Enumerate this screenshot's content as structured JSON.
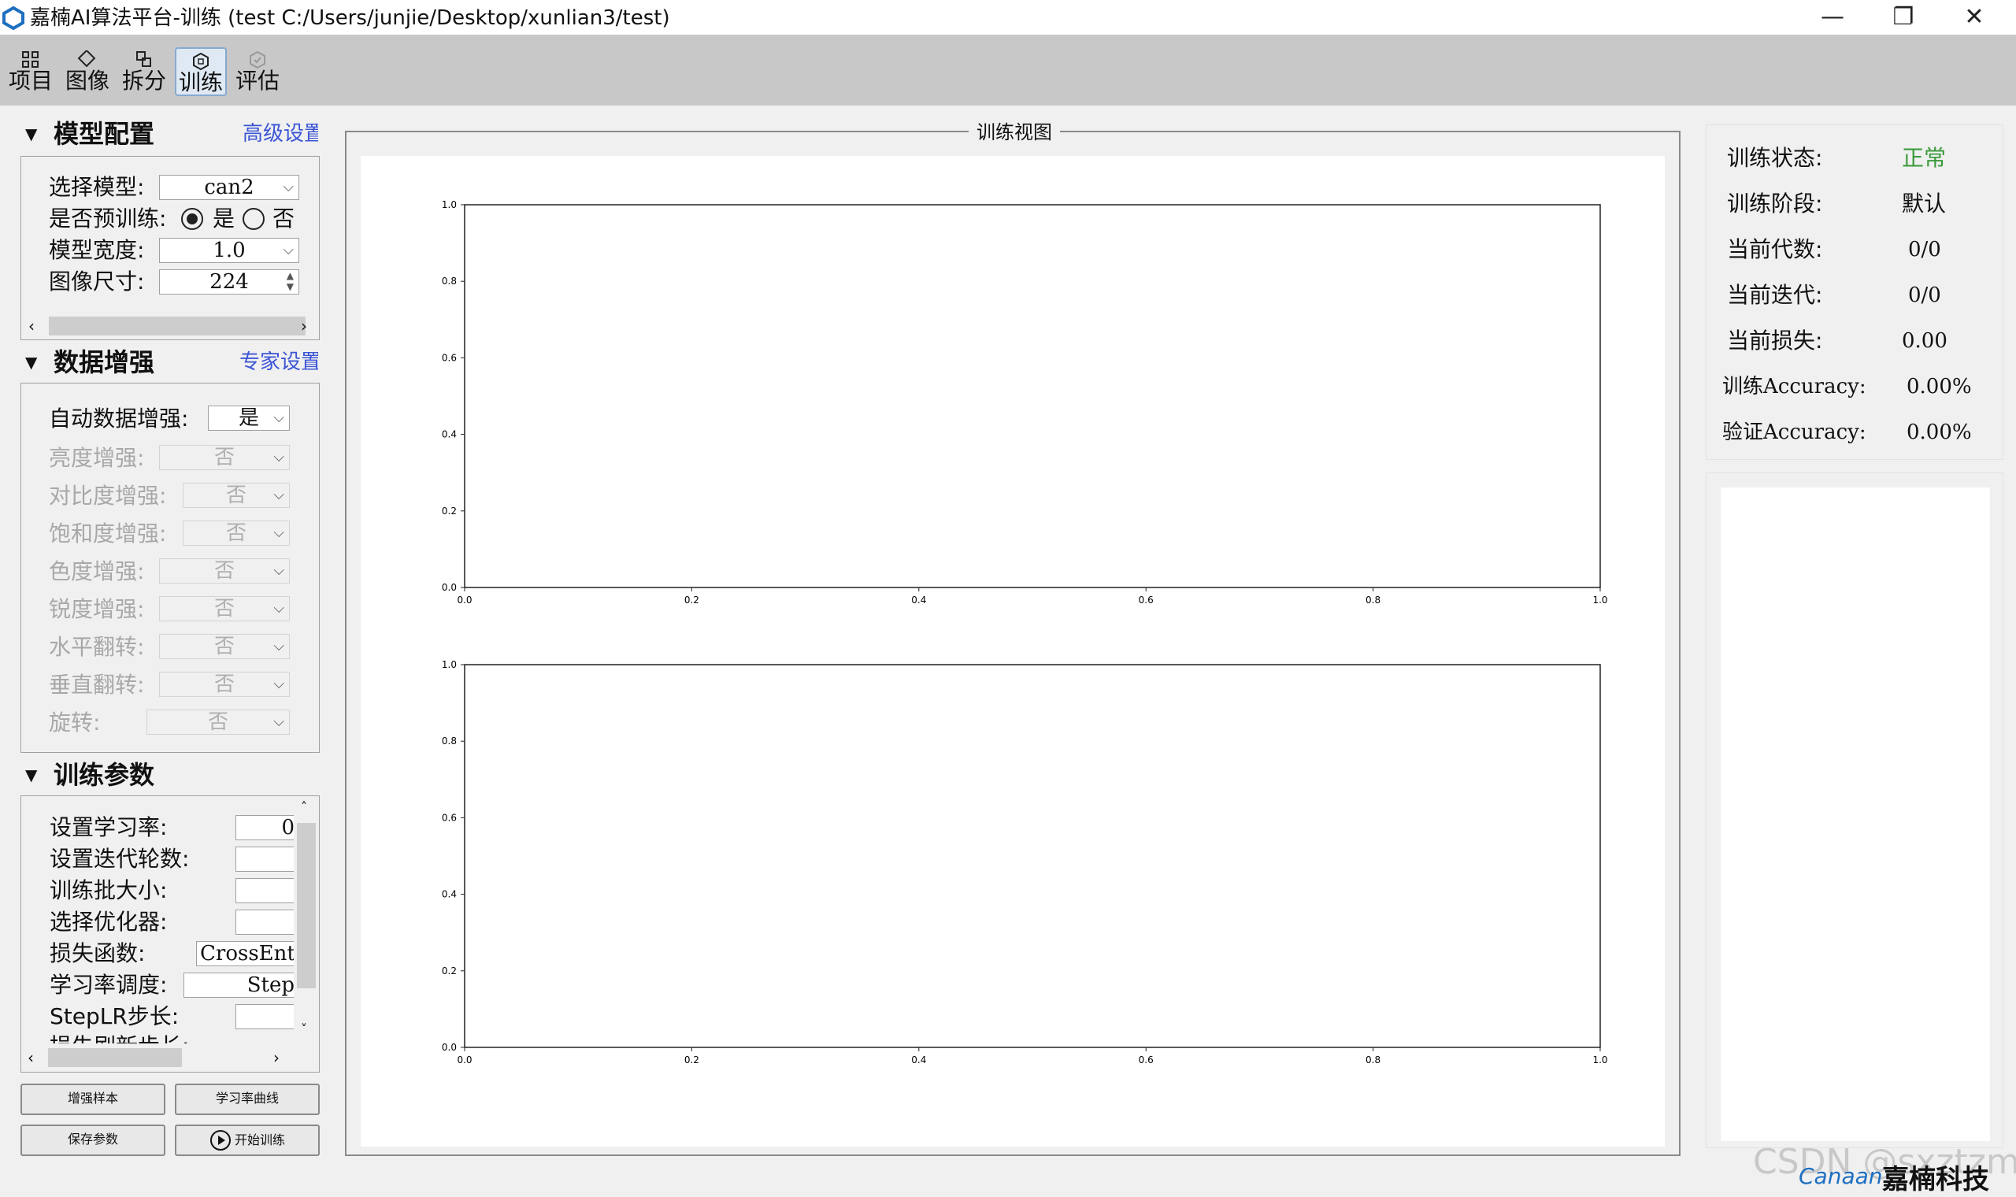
{
  "window": {
    "title": "嘉楠AI算法平台-训练 (test  C:/Users/junjie/Desktop/xunlian3/test)",
    "minimize": "—",
    "maximize": "❐",
    "close": "✕"
  },
  "toolbar": {
    "items": [
      {
        "label": "项目",
        "icon": "project-icon"
      },
      {
        "label": "图像",
        "icon": "image-icon"
      },
      {
        "label": "拆分",
        "icon": "split-icon"
      },
      {
        "label": "训练",
        "icon": "train-icon",
        "active": true
      },
      {
        "label": "评估",
        "icon": "evaluate-icon"
      }
    ]
  },
  "model_config": {
    "title": "模型配置",
    "advanced_link": "高级设置",
    "model_label": "选择模型:",
    "model_value": "can2",
    "pretrain_label": "是否预训练:",
    "pretrain_yes": "是",
    "pretrain_no": "否",
    "width_label": "模型宽度:",
    "width_value": "1.0",
    "size_label": "图像尺寸:",
    "size_value": "224"
  },
  "augment": {
    "title": "数据增强",
    "expert_link": "专家设置",
    "auto_label": "自动数据增强:",
    "auto_value": "是",
    "items": [
      {
        "label": "亮度增强:",
        "value": "否"
      },
      {
        "label": "对比度增强:",
        "value": "否"
      },
      {
        "label": "饱和度增强:",
        "value": "否"
      },
      {
        "label": "色度增强:",
        "value": "否"
      },
      {
        "label": "锐度增强:",
        "value": "否"
      },
      {
        "label": "水平翻转:",
        "value": "否"
      },
      {
        "label": "垂直翻转:",
        "value": "否"
      },
      {
        "label": "旋转:",
        "value": "否"
      }
    ]
  },
  "train_params": {
    "title": "训练参数",
    "lr_label": "设置学习率:",
    "lr_value": "0",
    "epochs_label": "设置迭代轮数:",
    "epochs_value": "",
    "batch_label": "训练批大小:",
    "batch_value": "",
    "optimizer_label": "选择优化器:",
    "optimizer_value": "",
    "loss_label": "损失函数:",
    "loss_value": "CrossEnt",
    "sched_label": "学习率调度:",
    "sched_value": "Step",
    "steplr_label": "StepLR步长:",
    "steplr_value": "",
    "partial_label": "损失刷新步长:"
  },
  "buttons": {
    "augment_sample": "增强样本",
    "lr_curve": "学习率曲线",
    "save_params": "保存参数",
    "start_train": "开始训练"
  },
  "view": {
    "title": "训练视图"
  },
  "status": {
    "state_label": "训练状态:",
    "state_value": "正常",
    "state_color": "#3a9a3a",
    "stage_label": "训练阶段:",
    "stage_value": "默认",
    "epoch_label": "当前代数:",
    "epoch_value": "0/0",
    "iter_label": "当前迭代:",
    "iter_value": "0/0",
    "loss_label": "当前损失:",
    "loss_value": "0.00",
    "train_acc_label": "训练Accuracy:",
    "train_acc_value": "0.00%",
    "val_acc_label": "验证Accuracy:",
    "val_acc_value": "0.00%"
  },
  "footer": {
    "brand_en": "Canaan",
    "brand_cn": "嘉楠科技",
    "watermark": "CSDN @sxztzm"
  },
  "chart_data": [
    {
      "type": "line",
      "series": [],
      "xlim": [
        0.0,
        1.0
      ],
      "ylim": [
        0.0,
        1.0
      ],
      "xticks": [
        "0.0",
        "0.2",
        "0.4",
        "0.6",
        "0.8",
        "1.0"
      ],
      "yticks": [
        "0.0",
        "0.2",
        "0.4",
        "0.6",
        "0.8",
        "1.0"
      ],
      "title": "",
      "xlabel": "",
      "ylabel": "",
      "grid": false
    },
    {
      "type": "line",
      "series": [],
      "xlim": [
        0.0,
        1.0
      ],
      "ylim": [
        0.0,
        1.0
      ],
      "xticks": [
        "0.0",
        "0.2",
        "0.4",
        "0.6",
        "0.8",
        "1.0"
      ],
      "yticks": [
        "0.0",
        "0.2",
        "0.4",
        "0.6",
        "0.8",
        "1.0"
      ],
      "title": "",
      "xlabel": "",
      "ylabel": "",
      "grid": false
    }
  ]
}
